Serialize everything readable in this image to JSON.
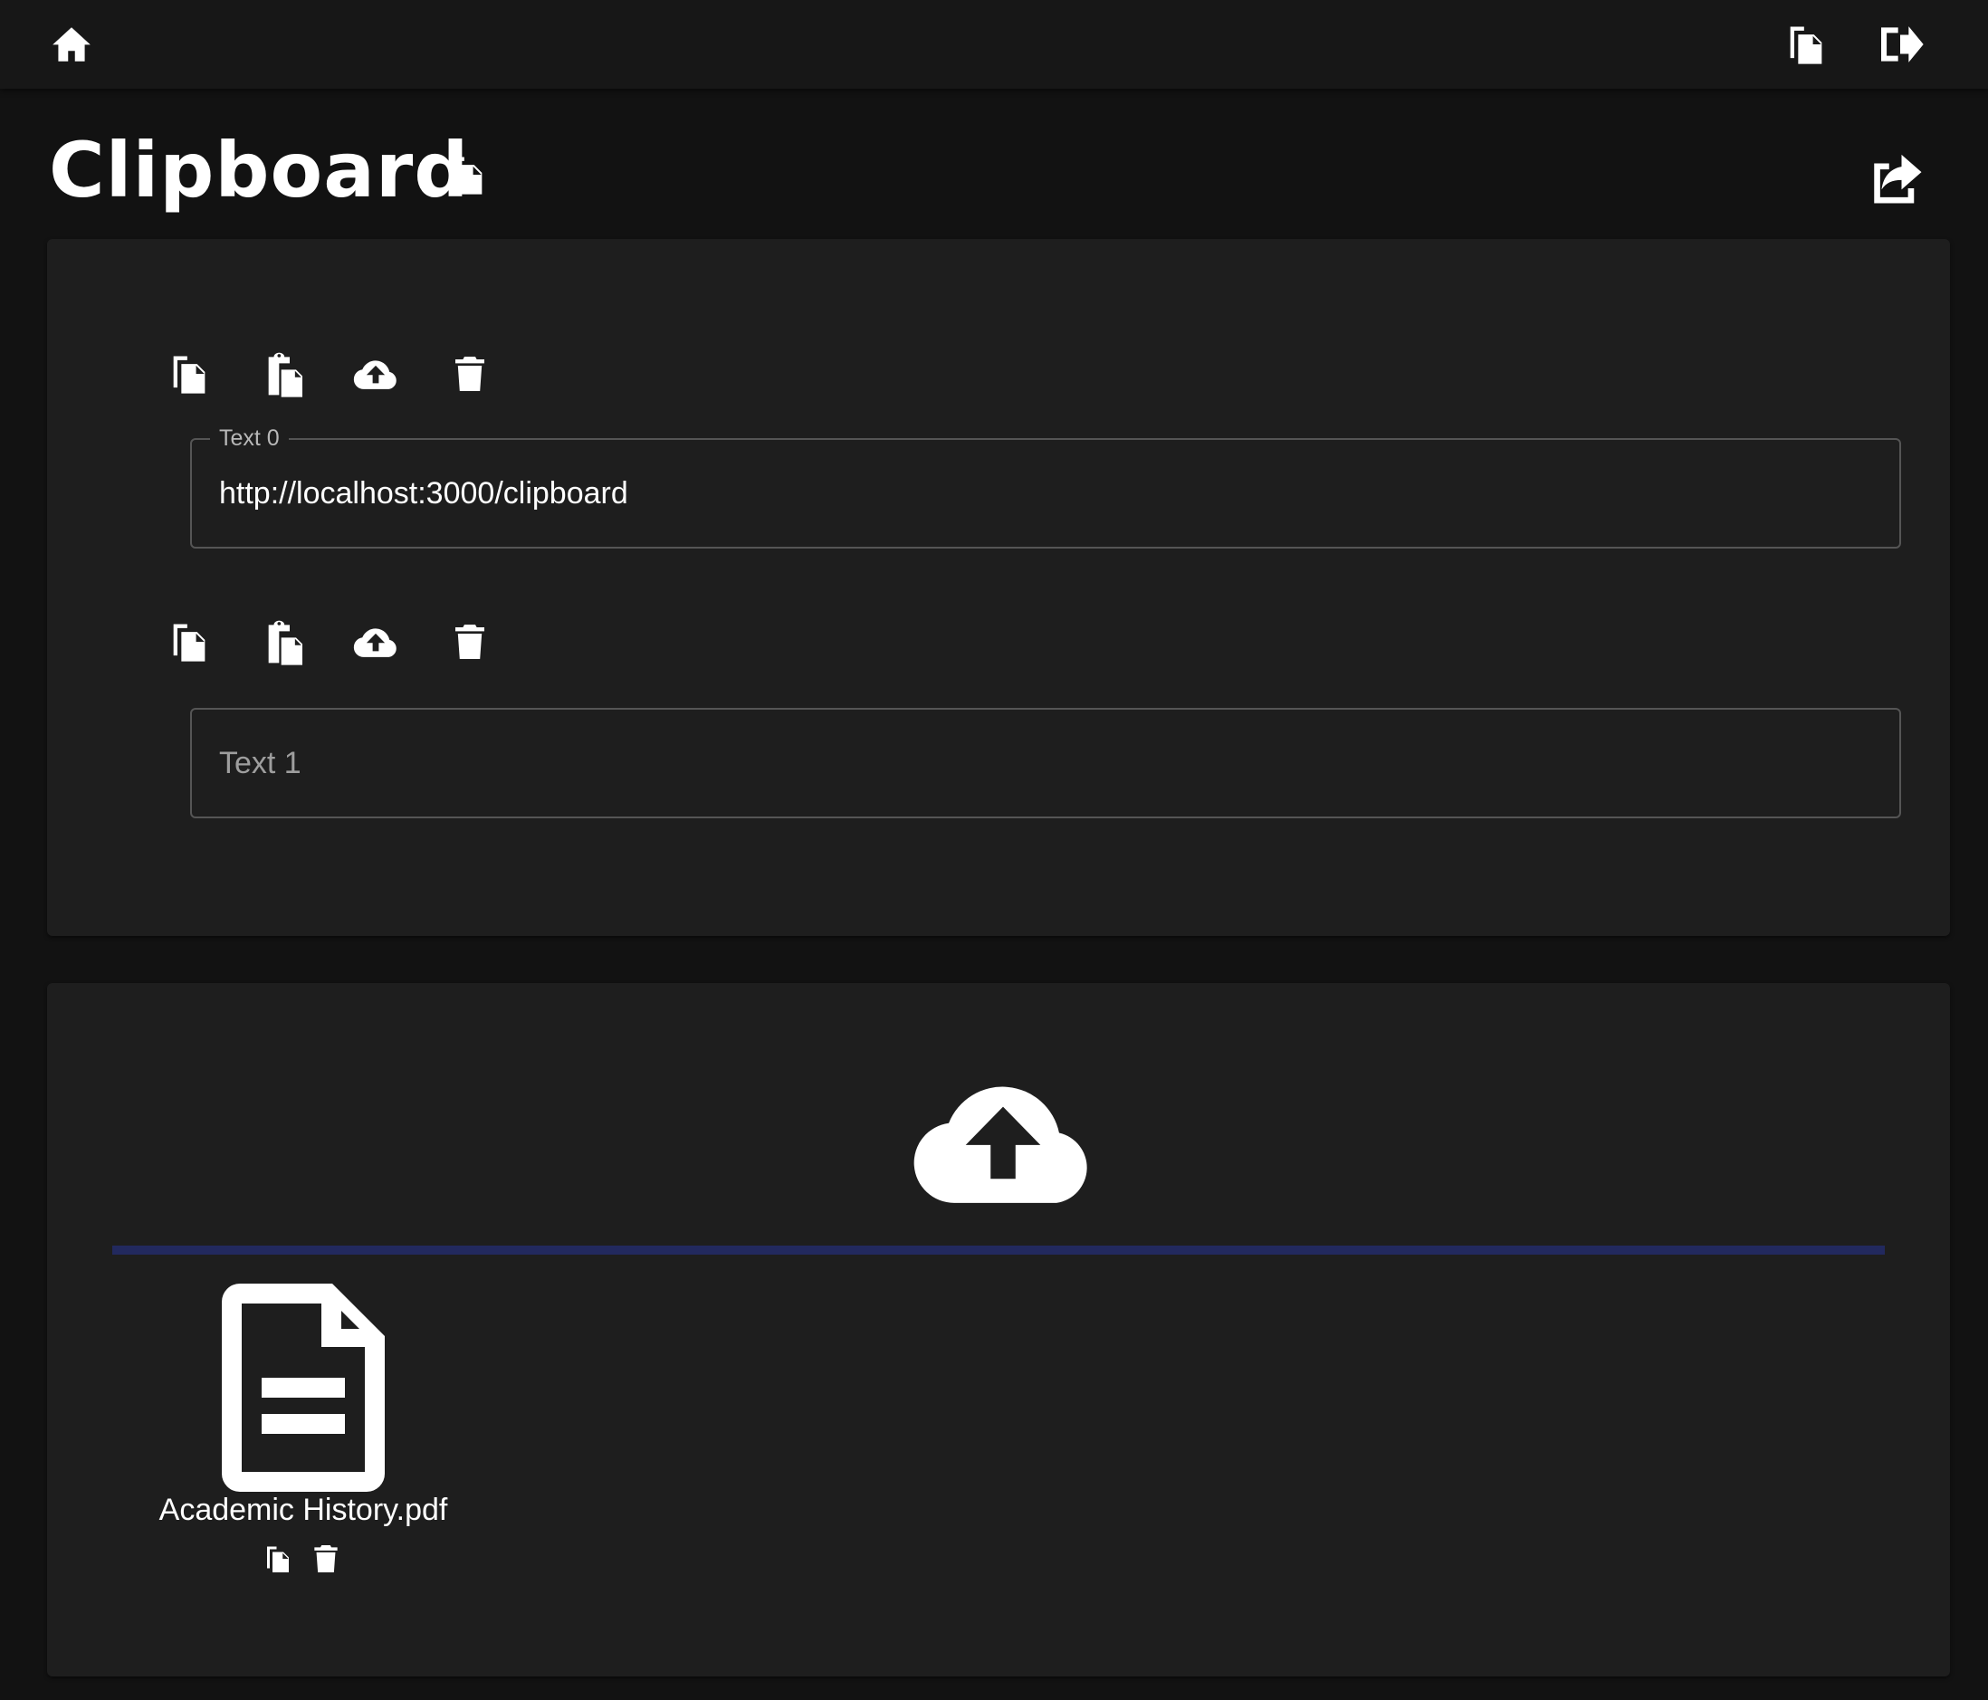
{
  "header": {
    "home_icon": "home-icon",
    "copy_icon": "copy-icon",
    "logout_icon": "logout-icon"
  },
  "page": {
    "title": "Clipboard",
    "title_icon": "copy-icon",
    "share_icon": "share-icon"
  },
  "text_entries": [
    {
      "label": "Text 0",
      "value": "http://localhost:3000/clipboard",
      "placeholder": "",
      "actions": [
        "copy-icon",
        "paste-icon",
        "upload-icon",
        "trash-icon"
      ]
    },
    {
      "label": "",
      "value": "",
      "placeholder": "Text 1",
      "actions": [
        "copy-icon",
        "paste-icon",
        "upload-icon",
        "trash-icon"
      ]
    }
  ],
  "upload": {
    "icon": "cloud-upload-icon",
    "progress": 1.0,
    "progress_color": "#22295e"
  },
  "files": [
    {
      "name": "Academic History.pdf",
      "icon": "file-document-icon",
      "actions": [
        "copy-icon",
        "trash-icon"
      ]
    }
  ],
  "colors": {
    "background": "#121212",
    "appbar": "#171717",
    "panel": "#1e1e1e",
    "accent": "#22295e"
  }
}
